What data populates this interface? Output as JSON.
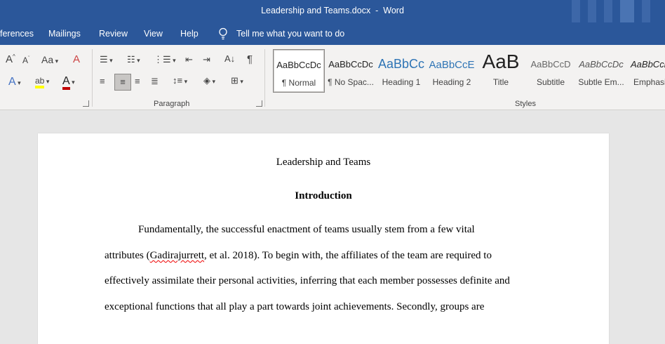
{
  "window": {
    "doc_name": "Leadership and Teams.docx",
    "app_name": "Word",
    "separator": "-"
  },
  "tabs": [
    "ferences",
    "Mailings",
    "Review",
    "View",
    "Help"
  ],
  "tell_me": "Tell me what you want to do",
  "ribbon": {
    "paragraph_label": "Paragraph",
    "styles_label": "Styles",
    "styles": [
      {
        "preview": "AaBbCcDc",
        "label": "¶ Normal"
      },
      {
        "preview": "AaBbCcDc",
        "label": "¶ No Spac..."
      },
      {
        "preview": "AaBbCc",
        "label": "Heading 1"
      },
      {
        "preview": "AaBbCcE",
        "label": "Heading 2"
      },
      {
        "preview": "AaB",
        "label": "Title"
      },
      {
        "preview": "AaBbCcD",
        "label": "Subtitle"
      },
      {
        "preview": "AaBbCcDc",
        "label": "Subtle Em..."
      },
      {
        "preview": "AaBbCcl",
        "label": "Emphasis"
      }
    ],
    "style_colors": {
      "heading": "#2e74b5",
      "text": "#222222"
    }
  },
  "document": {
    "title": "Leadership and Teams",
    "heading": "Introduction",
    "lines": [
      "Fundamentally, the successful enactment of teams usually stem from a few vital",
      "effectively assimilate their personal activities, inferring that each member possesses definite and",
      "exceptional functions that all play a part towards joint achievements. Secondly, groups are"
    ],
    "line2_prefix": "attributes (",
    "line2_misspelled": "Gadirajurrett",
    "line2_suffix": ", et al. 2018). To begin with, the affiliates of the team are required to"
  },
  "colors": {
    "accent": "#2b579a",
    "ribbon_bg": "#f3f2f1",
    "canvas_bg": "#e6e6e6",
    "font_red": "#c00000",
    "highlight": "#ffff00"
  }
}
